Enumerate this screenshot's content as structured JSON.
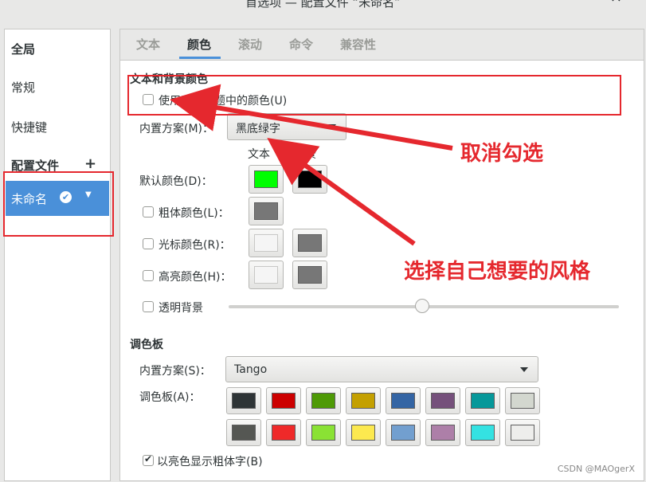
{
  "window": {
    "title": "首选项 — 配置文件 “未命名”",
    "close_glyph": "×"
  },
  "sidebar": {
    "items": [
      {
        "label": "全局"
      },
      {
        "label": "常规"
      },
      {
        "label": "快捷键"
      },
      {
        "label": "配置文件"
      }
    ],
    "add_glyph": "+",
    "selected_profile": "未命名",
    "check_glyph": "✔",
    "dropdown_glyph": "▼"
  },
  "tabs": [
    "文本",
    "颜色",
    "滚动",
    "命令",
    "兼容性"
  ],
  "section_text_bg": {
    "title": "文本和背景颜色",
    "use_system_theme": "使用系统主题中的颜色(U)",
    "builtin_label": "内置方案(M)：",
    "builtin_value": "黑底绿字",
    "col_text": "文本",
    "col_bg": "背景",
    "rows": [
      {
        "label": "默认颜色(D)：",
        "checkbox": false,
        "text_color": "#00ff00",
        "bg_color": "#000000"
      },
      {
        "label": "粗体颜色(L)：",
        "checkbox": true,
        "text_color": "#777777"
      },
      {
        "label": "光标颜色(R)：",
        "checkbox": true,
        "text_color": "#f5f5f5",
        "bg_color": "#777777"
      },
      {
        "label": "高亮颜色(H)：",
        "checkbox": true,
        "text_color": "#f5f5f5",
        "bg_color": "#777777"
      }
    ],
    "transparent_label": "透明背景",
    "transparency_value": 0.5
  },
  "palette_section": {
    "title": "调色板",
    "builtin_label": "内置方案(S)：",
    "builtin_value": "Tango",
    "palette_label": "调色板(A)：",
    "row1": [
      "#2e3436",
      "#cc0000",
      "#4e9a06",
      "#c4a000",
      "#3465a4",
      "#75507b",
      "#06989a",
      "#d3d7cf"
    ],
    "row2": [
      "#555753",
      "#ef2929",
      "#8ae234",
      "#fce94f",
      "#729fcf",
      "#ad7fa8",
      "#34e2e2",
      "#eeeeec"
    ],
    "bold_bright_label": "以亮色显示粗体字(B)"
  },
  "annotations": {
    "uncheck": "取消勾选",
    "choose_style": "选择自己想要的风格"
  },
  "watermark": "CSDN @MAOgerX",
  "colors": {
    "accent": "#4a90d9",
    "annotation_red": "#e5282e"
  }
}
